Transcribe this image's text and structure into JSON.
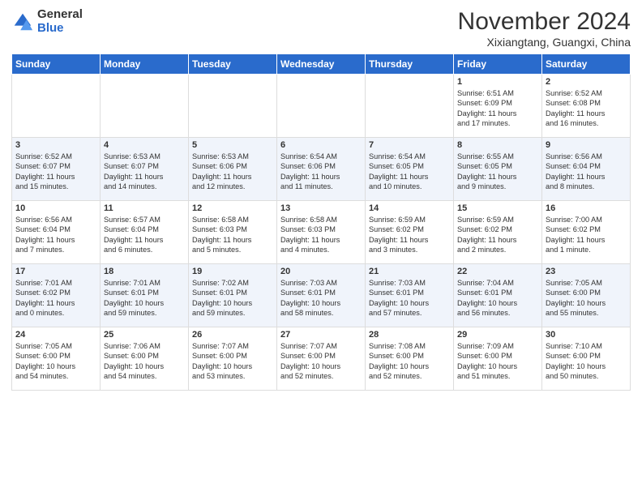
{
  "header": {
    "logo_general": "General",
    "logo_blue": "Blue",
    "month_title": "November 2024",
    "location": "Xixiangtang, Guangxi, China"
  },
  "days_of_week": [
    "Sunday",
    "Monday",
    "Tuesday",
    "Wednesday",
    "Thursday",
    "Friday",
    "Saturday"
  ],
  "weeks": [
    [
      {
        "num": "",
        "info": ""
      },
      {
        "num": "",
        "info": ""
      },
      {
        "num": "",
        "info": ""
      },
      {
        "num": "",
        "info": ""
      },
      {
        "num": "",
        "info": ""
      },
      {
        "num": "1",
        "info": "Sunrise: 6:51 AM\nSunset: 6:09 PM\nDaylight: 11 hours\nand 17 minutes."
      },
      {
        "num": "2",
        "info": "Sunrise: 6:52 AM\nSunset: 6:08 PM\nDaylight: 11 hours\nand 16 minutes."
      }
    ],
    [
      {
        "num": "3",
        "info": "Sunrise: 6:52 AM\nSunset: 6:07 PM\nDaylight: 11 hours\nand 15 minutes."
      },
      {
        "num": "4",
        "info": "Sunrise: 6:53 AM\nSunset: 6:07 PM\nDaylight: 11 hours\nand 14 minutes."
      },
      {
        "num": "5",
        "info": "Sunrise: 6:53 AM\nSunset: 6:06 PM\nDaylight: 11 hours\nand 12 minutes."
      },
      {
        "num": "6",
        "info": "Sunrise: 6:54 AM\nSunset: 6:06 PM\nDaylight: 11 hours\nand 11 minutes."
      },
      {
        "num": "7",
        "info": "Sunrise: 6:54 AM\nSunset: 6:05 PM\nDaylight: 11 hours\nand 10 minutes."
      },
      {
        "num": "8",
        "info": "Sunrise: 6:55 AM\nSunset: 6:05 PM\nDaylight: 11 hours\nand 9 minutes."
      },
      {
        "num": "9",
        "info": "Sunrise: 6:56 AM\nSunset: 6:04 PM\nDaylight: 11 hours\nand 8 minutes."
      }
    ],
    [
      {
        "num": "10",
        "info": "Sunrise: 6:56 AM\nSunset: 6:04 PM\nDaylight: 11 hours\nand 7 minutes."
      },
      {
        "num": "11",
        "info": "Sunrise: 6:57 AM\nSunset: 6:04 PM\nDaylight: 11 hours\nand 6 minutes."
      },
      {
        "num": "12",
        "info": "Sunrise: 6:58 AM\nSunset: 6:03 PM\nDaylight: 11 hours\nand 5 minutes."
      },
      {
        "num": "13",
        "info": "Sunrise: 6:58 AM\nSunset: 6:03 PM\nDaylight: 11 hours\nand 4 minutes."
      },
      {
        "num": "14",
        "info": "Sunrise: 6:59 AM\nSunset: 6:02 PM\nDaylight: 11 hours\nand 3 minutes."
      },
      {
        "num": "15",
        "info": "Sunrise: 6:59 AM\nSunset: 6:02 PM\nDaylight: 11 hours\nand 2 minutes."
      },
      {
        "num": "16",
        "info": "Sunrise: 7:00 AM\nSunset: 6:02 PM\nDaylight: 11 hours\nand 1 minute."
      }
    ],
    [
      {
        "num": "17",
        "info": "Sunrise: 7:01 AM\nSunset: 6:02 PM\nDaylight: 11 hours\nand 0 minutes."
      },
      {
        "num": "18",
        "info": "Sunrise: 7:01 AM\nSunset: 6:01 PM\nDaylight: 10 hours\nand 59 minutes."
      },
      {
        "num": "19",
        "info": "Sunrise: 7:02 AM\nSunset: 6:01 PM\nDaylight: 10 hours\nand 59 minutes."
      },
      {
        "num": "20",
        "info": "Sunrise: 7:03 AM\nSunset: 6:01 PM\nDaylight: 10 hours\nand 58 minutes."
      },
      {
        "num": "21",
        "info": "Sunrise: 7:03 AM\nSunset: 6:01 PM\nDaylight: 10 hours\nand 57 minutes."
      },
      {
        "num": "22",
        "info": "Sunrise: 7:04 AM\nSunset: 6:01 PM\nDaylight: 10 hours\nand 56 minutes."
      },
      {
        "num": "23",
        "info": "Sunrise: 7:05 AM\nSunset: 6:00 PM\nDaylight: 10 hours\nand 55 minutes."
      }
    ],
    [
      {
        "num": "24",
        "info": "Sunrise: 7:05 AM\nSunset: 6:00 PM\nDaylight: 10 hours\nand 54 minutes."
      },
      {
        "num": "25",
        "info": "Sunrise: 7:06 AM\nSunset: 6:00 PM\nDaylight: 10 hours\nand 54 minutes."
      },
      {
        "num": "26",
        "info": "Sunrise: 7:07 AM\nSunset: 6:00 PM\nDaylight: 10 hours\nand 53 minutes."
      },
      {
        "num": "27",
        "info": "Sunrise: 7:07 AM\nSunset: 6:00 PM\nDaylight: 10 hours\nand 52 minutes."
      },
      {
        "num": "28",
        "info": "Sunrise: 7:08 AM\nSunset: 6:00 PM\nDaylight: 10 hours\nand 52 minutes."
      },
      {
        "num": "29",
        "info": "Sunrise: 7:09 AM\nSunset: 6:00 PM\nDaylight: 10 hours\nand 51 minutes."
      },
      {
        "num": "30",
        "info": "Sunrise: 7:10 AM\nSunset: 6:00 PM\nDaylight: 10 hours\nand 50 minutes."
      }
    ]
  ]
}
